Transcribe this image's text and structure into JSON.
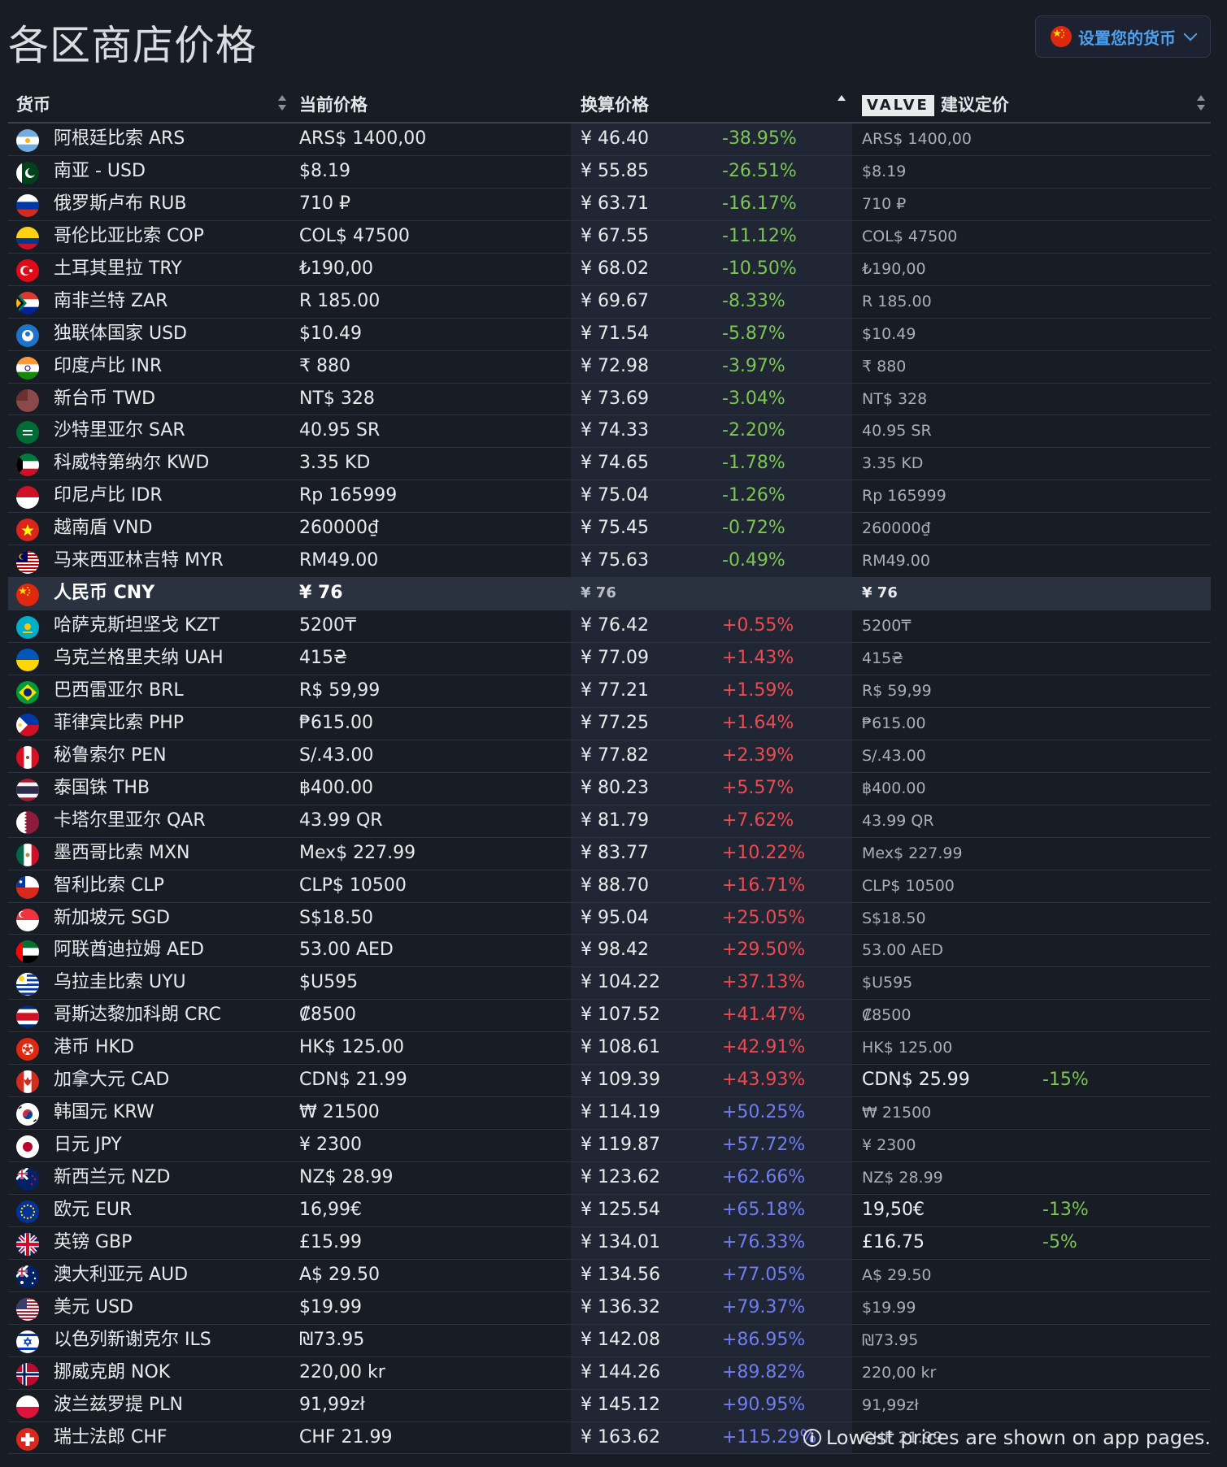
{
  "page": {
    "title": "各区商店价格"
  },
  "currency_button": {
    "label": "设置您的货币",
    "flag": "cn"
  },
  "headers": {
    "currency": "货币",
    "current_price": "当前价格",
    "converted_price": "换算价格",
    "valve_logo": "VALVE",
    "recommended": "建议定价"
  },
  "colors": {
    "discount": "#7cc653",
    "markup_low": "#ee4a4f",
    "markup_high": "#6f7df2",
    "background": "#181c25"
  },
  "rows": [
    {
      "flag": "ar",
      "name": "阿根廷比索 ARS",
      "price": "ARS$ 1400,00",
      "converted": "¥ 46.40",
      "pct": "-38.95%",
      "pct_color": "green",
      "rec": "ARS$ 1400,00",
      "rec_pct": ""
    },
    {
      "flag": "pk",
      "name": "南亚 - USD",
      "price": "$8.19",
      "converted": "¥ 55.85",
      "pct": "-26.51%",
      "pct_color": "green",
      "rec": "$8.19",
      "rec_pct": ""
    },
    {
      "flag": "ru",
      "name": "俄罗斯卢布 RUB",
      "price": "710 ₽",
      "converted": "¥ 63.71",
      "pct": "-16.17%",
      "pct_color": "green",
      "rec": "710 ₽",
      "rec_pct": ""
    },
    {
      "flag": "co",
      "name": "哥伦比亚比索 COP",
      "price": "COL$ 47500",
      "converted": "¥ 67.55",
      "pct": "-11.12%",
      "pct_color": "green",
      "rec": "COL$ 47500",
      "rec_pct": ""
    },
    {
      "flag": "tr",
      "name": "土耳其里拉 TRY",
      "price": "₺190,00",
      "converted": "¥ 68.02",
      "pct": "-10.50%",
      "pct_color": "green",
      "rec": "₺190,00",
      "rec_pct": ""
    },
    {
      "flag": "za",
      "name": "南非兰特 ZAR",
      "price": "R 185.00",
      "converted": "¥ 69.67",
      "pct": "-8.33%",
      "pct_color": "green",
      "rec": "R 185.00",
      "rec_pct": ""
    },
    {
      "flag": "cis",
      "name": "独联体国家 USD",
      "price": "$10.49",
      "converted": "¥ 71.54",
      "pct": "-5.87%",
      "pct_color": "green",
      "rec": "$10.49",
      "rec_pct": ""
    },
    {
      "flag": "in",
      "name": "印度卢比 INR",
      "price": "₹ 880",
      "converted": "¥ 72.98",
      "pct": "-3.97%",
      "pct_color": "green",
      "rec": "₹ 880",
      "rec_pct": ""
    },
    {
      "flag": "tw",
      "name": "新台币 TWD",
      "price": "NT$ 328",
      "converted": "¥ 73.69",
      "pct": "-3.04%",
      "pct_color": "green",
      "rec": "NT$ 328",
      "rec_pct": ""
    },
    {
      "flag": "sa",
      "name": "沙特里亚尔 SAR",
      "price": "40.95 SR",
      "converted": "¥ 74.33",
      "pct": "-2.20%",
      "pct_color": "green",
      "rec": "40.95 SR",
      "rec_pct": ""
    },
    {
      "flag": "kw",
      "name": "科威特第纳尔 KWD",
      "price": "3.35 KD",
      "converted": "¥ 74.65",
      "pct": "-1.78%",
      "pct_color": "green",
      "rec": "3.35 KD",
      "rec_pct": ""
    },
    {
      "flag": "id",
      "name": "印尼卢比 IDR",
      "price": "Rp 165999",
      "converted": "¥ 75.04",
      "pct": "-1.26%",
      "pct_color": "green",
      "rec": "Rp 165999",
      "rec_pct": ""
    },
    {
      "flag": "vn",
      "name": "越南盾 VND",
      "price": "260000₫",
      "converted": "¥ 75.45",
      "pct": "-0.72%",
      "pct_color": "green",
      "rec": "260000₫",
      "rec_pct": ""
    },
    {
      "flag": "my",
      "name": "马来西亚林吉特 MYR",
      "price": "RM49.00",
      "converted": "¥ 75.63",
      "pct": "-0.49%",
      "pct_color": "green",
      "rec": "RM49.00",
      "rec_pct": ""
    },
    {
      "flag": "cn",
      "name": "人民币 CNY",
      "price": "¥ 76",
      "converted": "¥ 76",
      "pct": "",
      "pct_color": "green",
      "rec": "¥ 76",
      "rec_pct": "",
      "highlight": true
    },
    {
      "flag": "kz",
      "name": "哈萨克斯坦坚戈 KZT",
      "price": "5200₸",
      "converted": "¥ 76.42",
      "pct": "+0.55%",
      "pct_color": "red",
      "rec": "5200₸",
      "rec_pct": ""
    },
    {
      "flag": "ua",
      "name": "乌克兰格里夫纳 UAH",
      "price": "415₴",
      "converted": "¥ 77.09",
      "pct": "+1.43%",
      "pct_color": "red",
      "rec": "415₴",
      "rec_pct": ""
    },
    {
      "flag": "br",
      "name": "巴西雷亚尔 BRL",
      "price": "R$ 59,99",
      "converted": "¥ 77.21",
      "pct": "+1.59%",
      "pct_color": "red",
      "rec": "R$ 59,99",
      "rec_pct": ""
    },
    {
      "flag": "ph",
      "name": "菲律宾比索 PHP",
      "price": "₱615.00",
      "converted": "¥ 77.25",
      "pct": "+1.64%",
      "pct_color": "red",
      "rec": "₱615.00",
      "rec_pct": ""
    },
    {
      "flag": "pe",
      "name": "秘鲁索尔 PEN",
      "price": "S/.43.00",
      "converted": "¥ 77.82",
      "pct": "+2.39%",
      "pct_color": "red",
      "rec": "S/.43.00",
      "rec_pct": ""
    },
    {
      "flag": "th",
      "name": "泰国铢 THB",
      "price": "฿400.00",
      "converted": "¥ 80.23",
      "pct": "+5.57%",
      "pct_color": "red",
      "rec": "฿400.00",
      "rec_pct": ""
    },
    {
      "flag": "qa",
      "name": "卡塔尔里亚尔 QAR",
      "price": "43.99 QR",
      "converted": "¥ 81.79",
      "pct": "+7.62%",
      "pct_color": "red",
      "rec": "43.99 QR",
      "rec_pct": ""
    },
    {
      "flag": "mx",
      "name": "墨西哥比索 MXN",
      "price": "Mex$ 227.99",
      "converted": "¥ 83.77",
      "pct": "+10.22%",
      "pct_color": "red",
      "rec": "Mex$ 227.99",
      "rec_pct": ""
    },
    {
      "flag": "cl",
      "name": "智利比索 CLP",
      "price": "CLP$ 10500",
      "converted": "¥ 88.70",
      "pct": "+16.71%",
      "pct_color": "red",
      "rec": "CLP$ 10500",
      "rec_pct": ""
    },
    {
      "flag": "sg",
      "name": "新加坡元 SGD",
      "price": "S$18.50",
      "converted": "¥ 95.04",
      "pct": "+25.05%",
      "pct_color": "red",
      "rec": "S$18.50",
      "rec_pct": ""
    },
    {
      "flag": "ae",
      "name": "阿联酋迪拉姆 AED",
      "price": "53.00 AED",
      "converted": "¥ 98.42",
      "pct": "+29.50%",
      "pct_color": "red",
      "rec": "53.00 AED",
      "rec_pct": ""
    },
    {
      "flag": "uy",
      "name": "乌拉圭比索 UYU",
      "price": "$U595",
      "converted": "¥ 104.22",
      "pct": "+37.13%",
      "pct_color": "red",
      "rec": "$U595",
      "rec_pct": ""
    },
    {
      "flag": "cr",
      "name": "哥斯达黎加科朗 CRC",
      "price": "₡8500",
      "converted": "¥ 107.52",
      "pct": "+41.47%",
      "pct_color": "red",
      "rec": "₡8500",
      "rec_pct": ""
    },
    {
      "flag": "hk",
      "name": "港币 HKD",
      "price": "HK$ 125.00",
      "converted": "¥ 108.61",
      "pct": "+42.91%",
      "pct_color": "red",
      "rec": "HK$ 125.00",
      "rec_pct": ""
    },
    {
      "flag": "ca",
      "name": "加拿大元 CAD",
      "price": "CDN$ 21.99",
      "converted": "¥ 109.39",
      "pct": "+43.93%",
      "pct_color": "red",
      "rec": "CDN$ 25.99",
      "rec_pct": "-15%",
      "rec_strong": true
    },
    {
      "flag": "kr",
      "name": "韩国元 KRW",
      "price": "₩ 21500",
      "converted": "¥ 114.19",
      "pct": "+50.25%",
      "pct_color": "blue",
      "rec": "₩ 21500",
      "rec_pct": ""
    },
    {
      "flag": "jp",
      "name": "日元 JPY",
      "price": "¥ 2300",
      "converted": "¥ 119.87",
      "pct": "+57.72%",
      "pct_color": "blue",
      "rec": "¥ 2300",
      "rec_pct": ""
    },
    {
      "flag": "nz",
      "name": "新西兰元 NZD",
      "price": "NZ$ 28.99",
      "converted": "¥ 123.62",
      "pct": "+62.66%",
      "pct_color": "blue",
      "rec": "NZ$ 28.99",
      "rec_pct": ""
    },
    {
      "flag": "eu",
      "name": "欧元 EUR",
      "price": "16,99€",
      "converted": "¥ 125.54",
      "pct": "+65.18%",
      "pct_color": "blue",
      "rec": "19,50€",
      "rec_pct": "-13%",
      "rec_strong": true
    },
    {
      "flag": "gb",
      "name": "英镑 GBP",
      "price": "£15.99",
      "converted": "¥ 134.01",
      "pct": "+76.33%",
      "pct_color": "blue",
      "rec": "£16.75",
      "rec_pct": "-5%",
      "rec_strong": true
    },
    {
      "flag": "au",
      "name": "澳大利亚元 AUD",
      "price": "A$ 29.50",
      "converted": "¥ 134.56",
      "pct": "+77.05%",
      "pct_color": "blue",
      "rec": "A$ 29.50",
      "rec_pct": ""
    },
    {
      "flag": "us",
      "name": "美元 USD",
      "price": "$19.99",
      "converted": "¥ 136.32",
      "pct": "+79.37%",
      "pct_color": "blue",
      "rec": "$19.99",
      "rec_pct": ""
    },
    {
      "flag": "il",
      "name": "以色列新谢克尔 ILS",
      "price": "₪73.95",
      "converted": "¥ 142.08",
      "pct": "+86.95%",
      "pct_color": "blue",
      "rec": "₪73.95",
      "rec_pct": ""
    },
    {
      "flag": "no",
      "name": "挪威克朗 NOK",
      "price": "220,00 kr",
      "converted": "¥ 144.26",
      "pct": "+89.82%",
      "pct_color": "blue",
      "rec": "220,00 kr",
      "rec_pct": ""
    },
    {
      "flag": "pl",
      "name": "波兰兹罗提 PLN",
      "price": "91,99zł",
      "converted": "¥ 145.12",
      "pct": "+90.95%",
      "pct_color": "blue",
      "rec": "91,99zł",
      "rec_pct": ""
    },
    {
      "flag": "ch",
      "name": "瑞士法郎 CHF",
      "price": "CHF 21.99",
      "converted": "¥ 163.62",
      "pct": "+115.29%",
      "pct_color": "blue",
      "rec": "CHF 21.99",
      "rec_pct": ""
    }
  ],
  "footer": {
    "note": "Lowest prices are shown on app pages.",
    "icon": "info-icon"
  }
}
